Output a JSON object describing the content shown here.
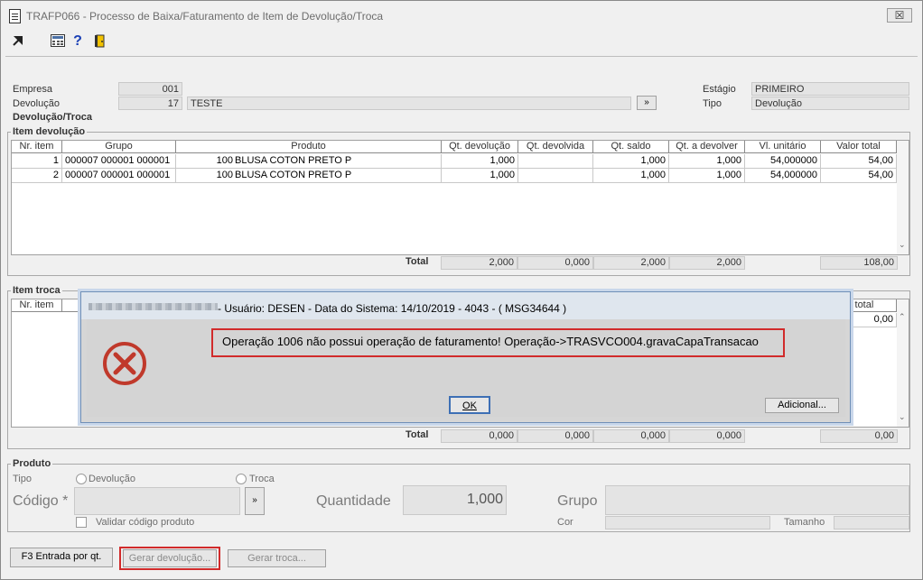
{
  "window": {
    "title": "TRAFP066 - Processo de Baixa/Faturamento de Item de Devolução/Troca",
    "close_label": "☒"
  },
  "toolbar": {
    "icons": [
      "arrow-icon",
      "calculator-icon",
      "help-icon",
      "exit-door-icon"
    ],
    "help_label": "?"
  },
  "header": {
    "empresa_label": "Empresa",
    "empresa_value": "001",
    "devolucao_label": "Devolução",
    "devolucao_value": "17",
    "devolucao_desc": "TESTE",
    "lookup_label": "»",
    "estagio_label": "Estágio",
    "estagio_value": "PRIMEIRO",
    "tipo_label": "Tipo",
    "tipo_value": "Devolução"
  },
  "devolucao_troca": {
    "title": "Devolução/Troca"
  },
  "item_devolucao": {
    "title": "Item devolução",
    "columns": [
      "Nr. item",
      "Grupo",
      "Produto",
      "Qt. devolução",
      "Qt. devolvida",
      "Qt. saldo",
      "Qt. a devolver",
      "Vl. unitário",
      "Valor total"
    ],
    "rows": [
      {
        "nr": "1",
        "grupo": "000007 000001 000001",
        "produto_cod": "100",
        "produto": "BLUSA COTON PRETO P",
        "qt_dev": "1,000",
        "qt_devolvida": "",
        "qt_saldo": "1,000",
        "qt_a_dev": "1,000",
        "vl_unit": "54,000000",
        "vl_total": "54,00"
      },
      {
        "nr": "2",
        "grupo": "000007 000001 000001",
        "produto_cod": "100",
        "produto": "BLUSA COTON PRETO P",
        "qt_dev": "1,000",
        "qt_devolvida": "",
        "qt_saldo": "1,000",
        "qt_a_dev": "1,000",
        "vl_unit": "54,000000",
        "vl_total": "54,00"
      }
    ],
    "total_label": "Total",
    "totals": {
      "qt_dev": "2,000",
      "qt_devolvida": "0,000",
      "qt_saldo": "2,000",
      "qt_a_dev": "2,000",
      "vl_total": "108,00"
    }
  },
  "item_troca": {
    "title": "Item troca",
    "col_nr": "Nr. item",
    "col_valor_total": "or total",
    "row_valor_total": "0,00",
    "total_label": "Total",
    "totals": {
      "t1": "0,000",
      "t2": "0,000",
      "t3": "0,000",
      "t4": "0,000",
      "vl_total": "0,00"
    }
  },
  "dialog": {
    "title": "- Usuário: DESEN - Data do Sistema: 14/10/2019 - 4043 - ( MSG34644 )",
    "message": "Operação 1006 não possui operação de faturamento! Operação->TRASVCO004.gravaCapaTransacao",
    "ok_label": "OK",
    "extra_label": "Adicional...",
    "accent": "#c0392b"
  },
  "produto": {
    "title": "Produto",
    "tipo_label": "Tipo",
    "radio_devolucao": "Devolução",
    "radio_troca": "Troca",
    "codigo_label": "Código *",
    "lookup_label": "»",
    "quantidade_label": "Quantidade",
    "quantidade_value": "1,000",
    "grupo_label": "Grupo",
    "validar_label": "Validar código produto",
    "cor_label": "Cor",
    "tamanho_label": "Tamanho"
  },
  "buttons": {
    "entrada": "F3 Entrada por qt.",
    "gerar_devolucao": "Gerar devolução...",
    "gerar_troca": "Gerar troca..."
  },
  "colors": {
    "highlight": "#d12b2b",
    "disabled_text": "#8a8a8a"
  }
}
